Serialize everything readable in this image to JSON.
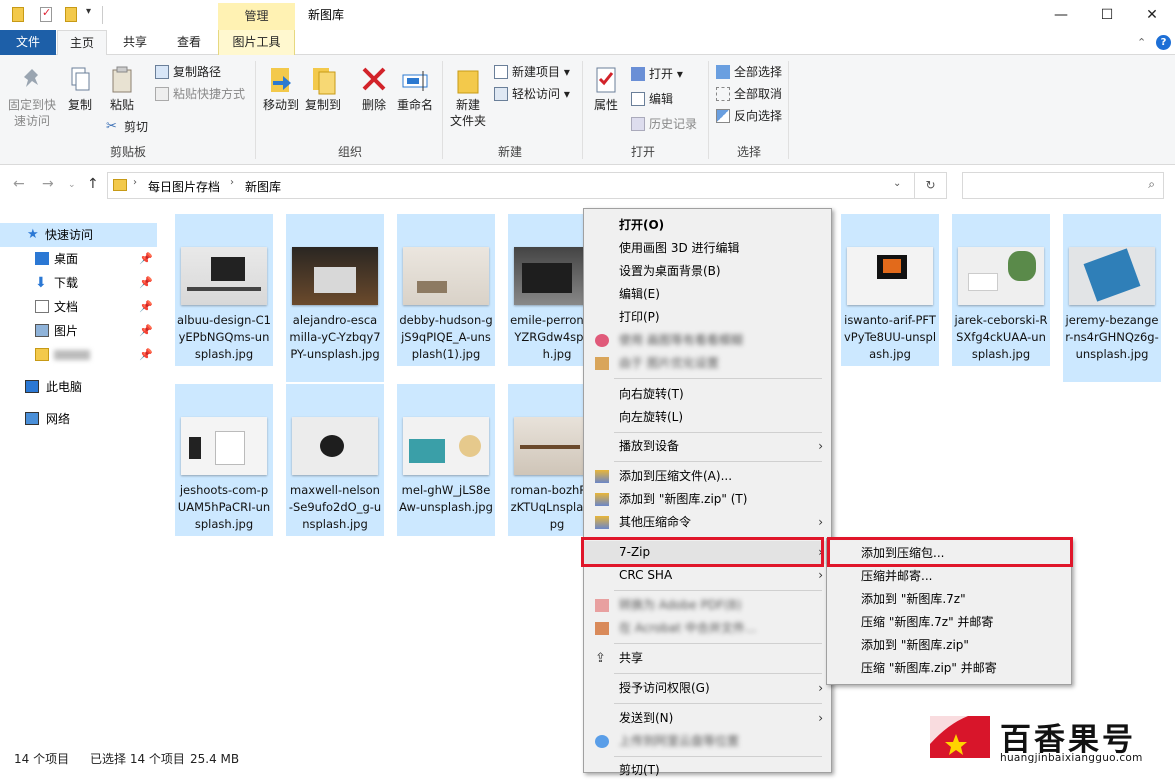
{
  "window": {
    "title": "新图库",
    "context_tab": "管理",
    "controls": {
      "minimize": "—",
      "maximize": "☐",
      "close": "✕"
    }
  },
  "tabs": {
    "file": "文件",
    "home": "主页",
    "share": "共享",
    "view": "查看",
    "picture_tools": "图片工具"
  },
  "ribbon": {
    "clipboard": {
      "pin": "固定到快速访问",
      "pin_line1": "固定到快",
      "pin_line2": "速访问",
      "copy": "复制",
      "paste": "粘贴",
      "copy_path": "复制路径",
      "paste_shortcut": "粘贴快捷方式",
      "cut": "剪切",
      "label": "剪贴板"
    },
    "organize": {
      "move_to": "移动到",
      "copy_to": "复制到",
      "delete": "删除",
      "rename": "重命名",
      "label": "组织"
    },
    "new": {
      "new_folder_line1": "新建",
      "new_folder_line2": "文件夹",
      "new_item": "新建项目",
      "easy_access": "轻松访问",
      "label": "新建"
    },
    "open": {
      "properties": "属性",
      "open": "打开",
      "edit": "编辑",
      "history": "历史记录",
      "label": "打开"
    },
    "select": {
      "select_all": "全部选择",
      "select_none": "全部取消",
      "invert": "反向选择",
      "label": "选择"
    }
  },
  "address": {
    "crumbs": [
      "每日图片存档",
      "新图库"
    ],
    "search_placeholder": ""
  },
  "nav": {
    "quick_access": "快速访问",
    "desktop": "桌面",
    "downloads": "下载",
    "documents": "文档",
    "pictures": "图片",
    "this_pc": "此电脑",
    "network": "网络"
  },
  "files": [
    {
      "name": "albuu-design-C1yEPbNGQms-unsplash.jpg"
    },
    {
      "name": "alejandro-escamilla-yC-Yzbqy7PY-unsplash.jpg"
    },
    {
      "name": "debby-hudson-gjS9qPIQE_A-unsplash(1).jpg"
    },
    {
      "name": "emile-perron-VDYZRGdw4splash.jpg"
    },
    {
      "name": "iswanto-arif-PFTvPyTe8UU-unsplash.jpg"
    },
    {
      "name": "jarek-ceborski-RSXfg4ckUAA-unsplash.jpg"
    },
    {
      "name": "jeremy-bezanger-ns4rGHNQz6g-unsplash.jpg"
    },
    {
      "name": "jeshoots-com-pUAM5hPaCRI-unsplash.jpg"
    },
    {
      "name": "maxwell-nelson-Se9ufo2dO_g-unsplash.jpg"
    },
    {
      "name": "mel-ghW_jLS8eAw-unsplash.jpg"
    },
    {
      "name": "roman-bozhPypjzKTUqLnsplash.jpg"
    }
  ],
  "context_menu": {
    "open": "打开(O)",
    "edit_3d": "使用画图 3D 进行编辑",
    "set_bg": "设置为桌面背景(B)",
    "edit": "编辑(E)",
    "print": "打印(P)",
    "blur1": "使用 画图等有看看模糊",
    "blur2": "由于 图片优化设置",
    "rotate_right": "向右旋转(T)",
    "rotate_left": "向左旋转(L)",
    "cast": "播放到设备",
    "add_archive": "添加到压缩文件(A)...",
    "add_zip": "添加到 \"新图库.zip\" (T)",
    "other_compress": "其他压缩命令",
    "sevenzip": "7-Zip",
    "crc": "CRC SHA",
    "blur3": "转换为 Adobe PDF(B)",
    "blur4": "在 Acrobat 中合并文件...",
    "share": "共享",
    "grant_access": "授予访问权限(G)",
    "send_to": "发送到(N)",
    "blur5": "上传到阿里云盘等位置",
    "cut": "剪切(T)"
  },
  "submenu": {
    "add_to_archive": "添加到压缩包...",
    "compress_email": "压缩并邮寄...",
    "add_7z": "添加到 \"新图库.7z\"",
    "compress_7z_email": "压缩 \"新图库.7z\" 并邮寄",
    "add_zip": "添加到 \"新图库.zip\"",
    "compress_zip_email": "压缩 \"新图库.zip\" 并邮寄"
  },
  "status": {
    "count": "14 个项目",
    "selected": "已选择 14 个项目",
    "size": "25.4 MB"
  },
  "watermark": {
    "brand": "百香果号",
    "url": "huangjinbaixiangguo.com"
  },
  "colors": {
    "selection": "#cce8ff",
    "file_tab": "#1d5fa8",
    "highlight_box": "#e0162a",
    "context_tab": "#fff2b3"
  }
}
